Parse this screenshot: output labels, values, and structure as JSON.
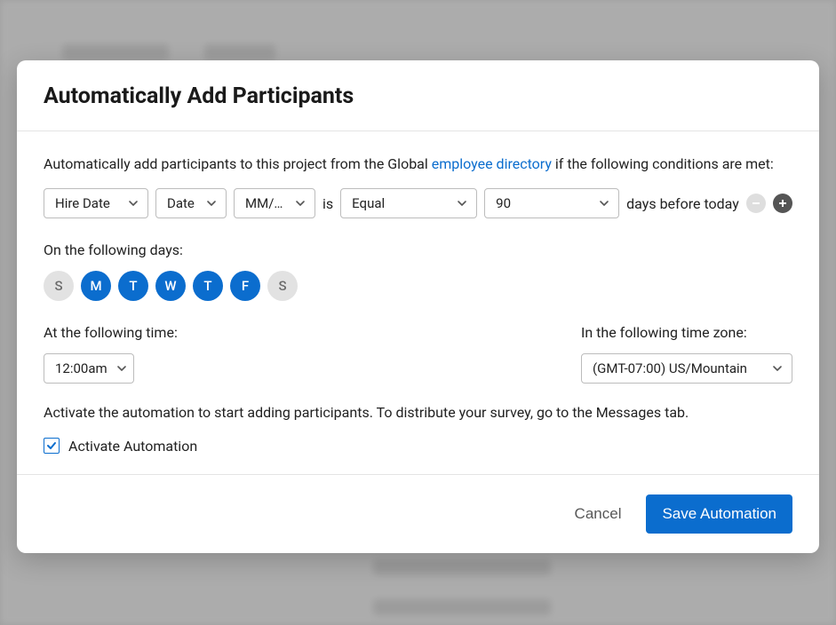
{
  "modal": {
    "title": "Automatically Add Participants",
    "intro_prefix": "Automatically add participants to this project from the Global ",
    "intro_link": "employee directory",
    "intro_suffix": " if the following conditions are met:",
    "condition": {
      "field": "Hire Date",
      "type": "Date",
      "format": "MM/…",
      "is_text": "is",
      "operator": "Equal",
      "value": "90",
      "suffix": "days before today"
    },
    "days_label": "On the following days:",
    "days": [
      {
        "label": "S",
        "active": false
      },
      {
        "label": "M",
        "active": true
      },
      {
        "label": "T",
        "active": true
      },
      {
        "label": "W",
        "active": true
      },
      {
        "label": "T",
        "active": true
      },
      {
        "label": "F",
        "active": true
      },
      {
        "label": "S",
        "active": false
      }
    ],
    "time_label": "At the following time:",
    "time_value": "12:00am",
    "tz_label": "In the following time zone:",
    "tz_value": "(GMT-07:00) US/Mountain",
    "activate_desc": "Activate the automation to start adding participants. To distribute your survey, go to the Messages tab.",
    "activate_checkbox_label": "Activate Automation",
    "activate_checked": true,
    "cancel_label": "Cancel",
    "save_label": "Save Automation"
  }
}
